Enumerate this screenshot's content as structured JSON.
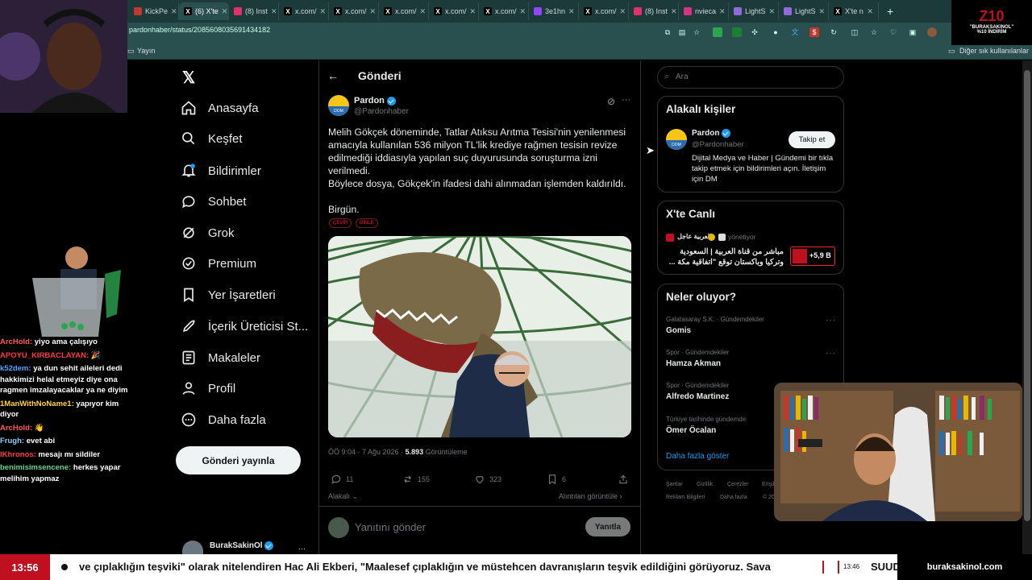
{
  "browser": {
    "tabs": [
      {
        "label": "KickPe",
        "icon": "kick-icon",
        "color": "#c0392b"
      },
      {
        "label": "(6) X'te",
        "icon": "x-icon",
        "color": "#ffffff",
        "active": true
      },
      {
        "label": "(8) Inst",
        "icon": "instagram-icon",
        "color": "#e1306c"
      },
      {
        "label": "x.com/",
        "icon": "x-icon",
        "color": "#ffffff"
      },
      {
        "label": "x.com/",
        "icon": "x-icon",
        "color": "#ffffff"
      },
      {
        "label": "x.com/",
        "icon": "x-icon",
        "color": "#ffffff"
      },
      {
        "label": "x.com/",
        "icon": "x-icon",
        "color": "#ffffff"
      },
      {
        "label": "x.com/",
        "icon": "x-icon",
        "color": "#ffffff"
      },
      {
        "label": "3e1hn",
        "icon": "twitch-icon",
        "color": "#9146ff"
      },
      {
        "label": "x.com/",
        "icon": "x-icon",
        "color": "#ffffff"
      },
      {
        "label": "(8) Inst",
        "icon": "instagram-icon",
        "color": "#e1306c"
      },
      {
        "label": "nvieca",
        "icon": "nvidia-icon",
        "color": "#d63384"
      },
      {
        "label": "LightS",
        "icon": "lightshot-icon",
        "color": "#8e6bd8"
      },
      {
        "label": "LightS",
        "icon": "lightshot-icon",
        "color": "#8e6bd8"
      },
      {
        "label": "X'te n",
        "icon": "x-icon",
        "color": "#ffffff"
      }
    ],
    "url": "pardonhaber/status/2085608035691434182",
    "bookmarks": {
      "left": "Yayın",
      "right": "Diğer sık kullanılanlar"
    }
  },
  "nav": {
    "items": [
      {
        "label": "Anasayfa",
        "icon": "home-icon"
      },
      {
        "label": "Keşfet",
        "icon": "search-icon"
      },
      {
        "label": "Bildirimler",
        "icon": "bell-icon"
      },
      {
        "label": "Sohbet",
        "icon": "chat-icon"
      },
      {
        "label": "Grok",
        "icon": "grok-icon"
      },
      {
        "label": "Premium",
        "icon": "premium-icon"
      },
      {
        "label": "Yer İşaretleri",
        "icon": "bookmark-icon"
      },
      {
        "label": "İçerik Üreticisi St...",
        "icon": "rocket-icon"
      },
      {
        "label": "Makaleler",
        "icon": "article-icon"
      },
      {
        "label": "Profil",
        "icon": "person-icon"
      },
      {
        "label": "Daha fazla",
        "icon": "more-icon"
      }
    ],
    "post_button": "Gönderi yayınla",
    "account_name": "BurakSakinOl"
  },
  "post": {
    "header": "Gönderi",
    "author_name": "Pardon",
    "author_handle": "@Pardonhaber",
    "paragraphs": [
      "Melih Gökçek döneminde, Tatlar Atıksu Arıtma Tesisi'nin yenilenmesi amacıyla kullanılan 536 milyon TL'lik krediye rağmen tesisin revize edilmediği iddiasıyla yapılan suç duyurusunda soruşturma izni verilmedi.",
      "Böylece dosya, Gökçek'in ifadesi dahi alınmadan işlemden kaldırıldı.",
      "Birgün."
    ],
    "chips": [
      "ÇEVİR",
      "DİNLE"
    ],
    "meta_time": "ÖÖ 9:04 · 7 Ağu 2026 · ",
    "meta_views_count": "5.893",
    "meta_views_label": " Görüntüleme",
    "stats": {
      "replies": "11",
      "reposts": "155",
      "likes": "323",
      "bookmarks": "6"
    },
    "related_label": "Alakalı",
    "quotes_label": "Alıntıları görüntüle",
    "reply_placeholder": "Yanıtını gönder",
    "reply_button": "Yanıtla"
  },
  "right": {
    "search_placeholder": "Ara",
    "related": {
      "title": "Alakalı kişiler",
      "name": "Pardon",
      "handle": "@Pardonhaber",
      "follow": "Takip et",
      "bio": "Dijital Medya ve Haber | Gündemi bir tıkla takip etmek için bildirimleri açın. İletişim için DM"
    },
    "live": {
      "title": "X'te Canlı",
      "host": "العربية عاجل",
      "role": "yönetiyor",
      "text": "مباشر من قناة العربية | السعودية وتركيا وباكستان توقع \"اتفاقية مكة ...",
      "count": "+5,9 B"
    },
    "trends": {
      "title": "Neler oluyor?",
      "items": [
        {
          "category": "Galatasaray S.K. · Gündemdekiler",
          "name": "Gomis"
        },
        {
          "category": "Spor · Gündemdekiler",
          "name": "Hamza Akman"
        },
        {
          "category": "Spor · Gündemdekiler",
          "name": "Alfredo Martinez"
        },
        {
          "category": "Türkiye tarihinde gündemde",
          "name": "Ömer Öcalan"
        }
      ],
      "show_more": "Daha fazla göster"
    },
    "footer": [
      "Şartlar",
      "Gizlilik",
      "Çerezler",
      "Erişil",
      "Reklam Bilgileri",
      "Daha fazla",
      "© 20"
    ]
  },
  "chat": [
    {
      "user": "ArcHold",
      "user_color": "#ff5a5a",
      "text": "yiyo ama çalışıyo"
    },
    {
      "user": "APOYU_KIRBACLAYAN",
      "user_color": "#ff3b3b",
      "text": "🎉"
    },
    {
      "user": "k52dem",
      "user_color": "#4fa3ff",
      "text": "ya dun sehit aileleri dedi hakkimizi helal etmeyiz diye ona ragmen imzalayacaklar ya ne diyim"
    },
    {
      "user": "1ManWithNoName1",
      "user_color": "#ffd23b",
      "text": "yapıyor kim diyor"
    },
    {
      "user": "ArcHold",
      "user_color": "#ff5a5a",
      "text": "👋"
    },
    {
      "user": "Frugh",
      "user_color": "#8ad0ff",
      "text": "evet abi"
    },
    {
      "user": "lKhronos",
      "user_color": "#ff3b3b",
      "text": "mesajı mı sildiler"
    },
    {
      "user": "benimisimsencene",
      "user_color": "#6cd48a",
      "text": "herkes yapar melihim yapmaz"
    }
  ],
  "ticker": {
    "clock": "13:56",
    "text": "ve çıplaklığın teşviki\" olarak nitelendiren Hac Ali Ekberi, \"Maalesef çıplaklığın ve müstehcen davranışların teşvik edildiğini görüyoruz. Sava",
    "sub_time": "13:46",
    "sub_text": "SUUD",
    "brand": "buraksakinol.com"
  },
  "logo": {
    "mark": "Z10",
    "line1": "\"BURAKSAKINOL\"",
    "line2": "%10 İNDİRİM"
  }
}
